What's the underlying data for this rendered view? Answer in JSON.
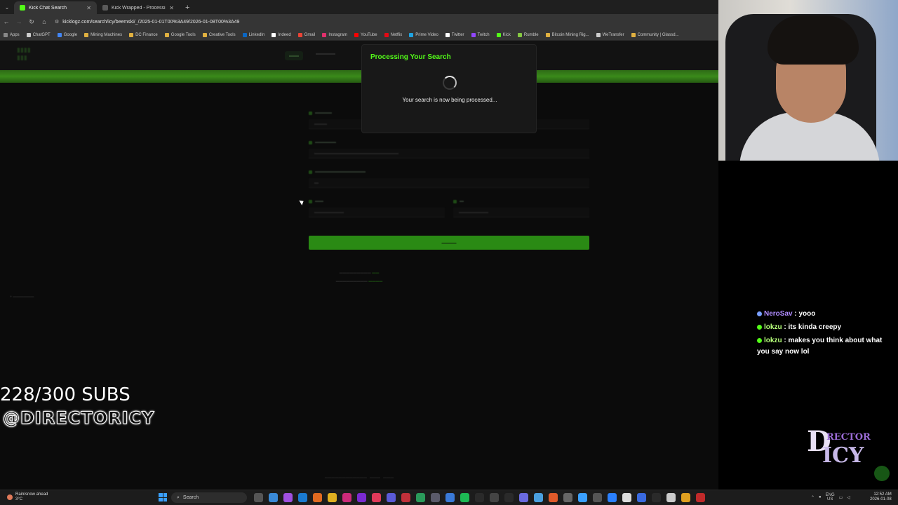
{
  "browser": {
    "tabs": [
      {
        "title": "Kick Chat Search",
        "active": true,
        "color": "#53fc18"
      },
      {
        "title": "Kick Wrapped - Processing",
        "active": false,
        "color": "#5a5a5a"
      }
    ],
    "url": "kicklogz.com/search/icy/beemski/_/2025-01-01T00%3A49/2026-01-08T00%3A49",
    "bookmarks": [
      {
        "label": "Apps",
        "color": "#888888"
      },
      {
        "label": "ChatGPT",
        "color": "#cccccc"
      },
      {
        "label": "Google",
        "color": "#4285f4"
      },
      {
        "label": "Mining Machines",
        "color": "#e0b040"
      },
      {
        "label": "DC Finance",
        "color": "#e0b040"
      },
      {
        "label": "Google Tools",
        "color": "#e0b040"
      },
      {
        "label": "Creative Tools",
        "color": "#e0b040"
      },
      {
        "label": "LinkedIn",
        "color": "#0a66c2"
      },
      {
        "label": "Indeed",
        "color": "#ffffff"
      },
      {
        "label": "Gmail",
        "color": "#ea4335"
      },
      {
        "label": "Instagram",
        "color": "#e1306c"
      },
      {
        "label": "YouTube",
        "color": "#ff0000"
      },
      {
        "label": "Netflix",
        "color": "#e50914"
      },
      {
        "label": "Prime Video",
        "color": "#1fa2e0"
      },
      {
        "label": "Twitter",
        "color": "#ffffff"
      },
      {
        "label": "Twitch",
        "color": "#9146ff"
      },
      {
        "label": "Kick",
        "color": "#53fc18"
      },
      {
        "label": "Rumble",
        "color": "#85c742"
      },
      {
        "label": "Bitcoin Mining Rig...",
        "color": "#e0b040"
      },
      {
        "label": "WeTransfer",
        "color": "#cccccc"
      },
      {
        "label": "Community | Glassd...",
        "color": "#e0b040"
      }
    ]
  },
  "modal": {
    "title": "Processing Your Search",
    "message": "Your search is now being processed..."
  },
  "chat": [
    {
      "user": "NeroSav",
      "message": "yooo"
    },
    {
      "user": "lokzu",
      "message": "its kinda creepy"
    },
    {
      "user": "lokzu",
      "message": "makes you think about what you say now lol"
    }
  ],
  "overlay": {
    "subs": "228/300 SUBS",
    "handle": "@DIRECTORICY"
  },
  "taskbar": {
    "weather_line1": "Rain/snow ahead",
    "weather_line2": "3°C",
    "search_label": "Search",
    "lang_line1": "ENG",
    "lang_line2": "US",
    "time": "12:52 AM",
    "date": "2026-01-08"
  },
  "colors": {
    "kick_green": "#53fc18",
    "accent_button": "#2a8a14"
  }
}
